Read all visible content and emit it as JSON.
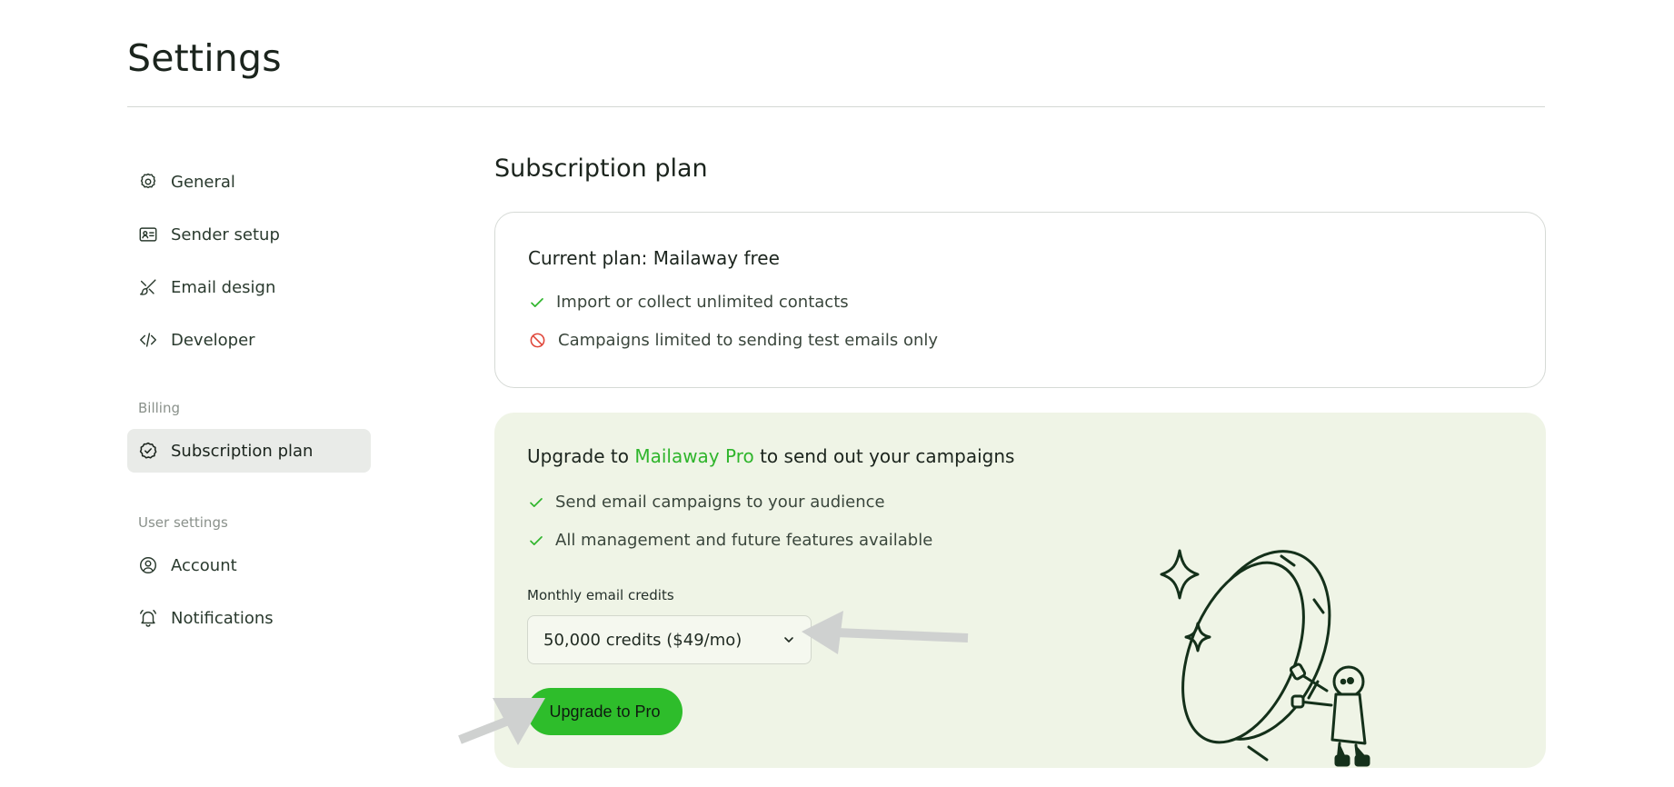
{
  "page": {
    "title": "Settings"
  },
  "sidebar": {
    "items": [
      {
        "label": "General",
        "icon": "gear-icon"
      },
      {
        "label": "Sender setup",
        "icon": "id-card-icon"
      },
      {
        "label": "Email design",
        "icon": "brush-icon"
      },
      {
        "label": "Developer",
        "icon": "code-icon"
      }
    ],
    "billing_label": "Billing",
    "billing_items": [
      {
        "label": "Subscription plan",
        "icon": "badge-check-icon",
        "active": true
      }
    ],
    "user_label": "User settings",
    "user_items": [
      {
        "label": "Account",
        "icon": "user-circle-icon"
      },
      {
        "label": "Notifications",
        "icon": "bell-icon"
      }
    ]
  },
  "main": {
    "heading": "Subscription plan",
    "current_plan": {
      "title": "Current plan: Mailaway free",
      "features": [
        {
          "text": "Import or collect unlimited contacts",
          "icon": "check-icon",
          "status": "included"
        },
        {
          "text": "Campaigns limited to sending test emails only",
          "icon": "prohibited-icon",
          "status": "restricted"
        }
      ]
    },
    "upgrade": {
      "title_prefix": "Upgrade to ",
      "title_accent": "Mailaway Pro",
      "title_suffix": " to send out your campaigns",
      "features": [
        {
          "text": "Send email campaigns to your audience",
          "icon": "check-icon"
        },
        {
          "text": "All management and future features available",
          "icon": "check-icon"
        }
      ],
      "credits_label": "Monthly email credits",
      "credits_selected": "50,000 credits ($49/mo)",
      "button_label": "Upgrade to Pro"
    }
  },
  "colors": {
    "accent_green": "#2fb52c",
    "button_green": "#2ebd2b",
    "restricted_red": "#e0463a",
    "upgrade_card_bg": "#eff4e6",
    "active_nav_bg": "#e9ebe8"
  }
}
